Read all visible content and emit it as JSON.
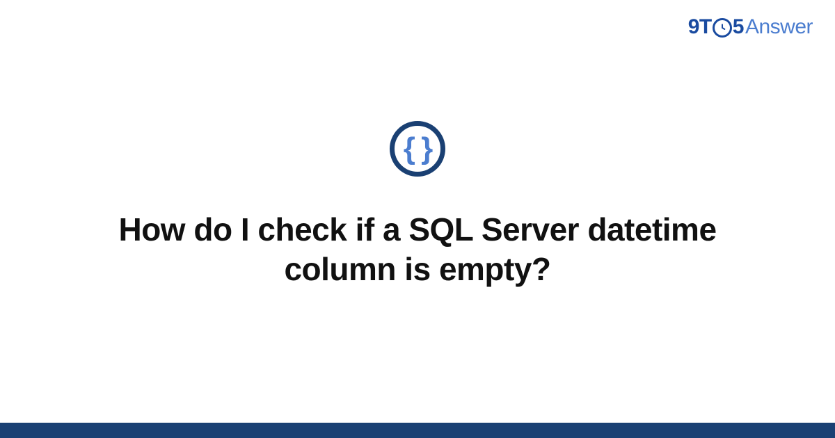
{
  "logo": {
    "part1": "9T",
    "part2": "5",
    "part3": "Answer"
  },
  "badge": {
    "glyph": "{ }"
  },
  "title": "How do I check if a SQL Server datetime column is empty?"
}
